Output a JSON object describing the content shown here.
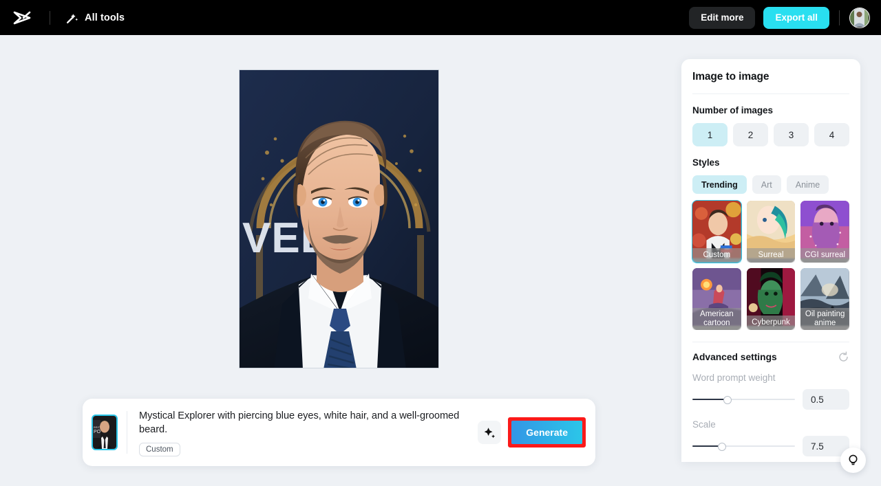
{
  "topbar": {
    "logo_icon": "capcut-logo-icon",
    "all_tools_label": "All tools",
    "all_tools_icon": "magic-wand-icon",
    "edit_more_label": "Edit more",
    "export_all_label": "Export all",
    "avatar_label": "user-avatar"
  },
  "colors": {
    "brand_cyan": "#29dff0",
    "accent_blue": "#3396e6",
    "selection_cyan": "#29c5e8",
    "chip_selected": "#cdeef5",
    "annotation_red": "#fb1a1a",
    "canvas_bg": "#eef1f5",
    "topbar_bg": "#000000"
  },
  "canvas": {
    "hero_image_alt": "AI generated portrait of bearded man with blue eyes in dark suit and navy tie",
    "hero_bg_text": "VEL"
  },
  "prompt_bar": {
    "thumbnail_alt": "reference photo of man in suit",
    "prompt_text": "Mystical Explorer with piercing blue eyes, white hair, and a well-groomed beard.",
    "tag_label": "Custom",
    "magic_icon": "sparkle-icon",
    "generate_label": "Generate"
  },
  "panel": {
    "title": "Image to image",
    "number_of_images": {
      "label": "Number of images",
      "options": [
        "1",
        "2",
        "3",
        "4"
      ],
      "selected": "1"
    },
    "styles": {
      "label": "Styles",
      "tabs": [
        {
          "label": "Trending",
          "selected": true
        },
        {
          "label": "Art",
          "selected": false
        },
        {
          "label": "Anime",
          "selected": false
        }
      ],
      "tiles": [
        {
          "label": "Custom",
          "selected": true
        },
        {
          "label": "Surreal",
          "selected": false
        },
        {
          "label": "CGI surreal",
          "selected": false
        },
        {
          "label": "American cartoon",
          "selected": false
        },
        {
          "label": "Cyberpunk",
          "selected": false
        },
        {
          "label": "Oil painting anime",
          "selected": false
        }
      ]
    },
    "advanced": {
      "title": "Advanced settings",
      "reset_icon": "reset-arrow-icon",
      "sliders": [
        {
          "label": "Word prompt weight",
          "value": "0.5",
          "percent": 34
        },
        {
          "label": "Scale",
          "value": "7.5",
          "percent": 29
        }
      ]
    }
  },
  "help": {
    "icon": "lightbulb-icon"
  }
}
